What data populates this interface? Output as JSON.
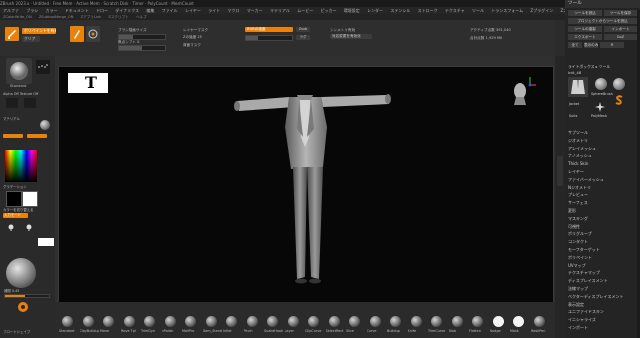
{
  "titlebar": {
    "text": "ZBrush 2023.x  ·  Untitled  ·  Free Mem  ·  Active Mem  ·  Scratch Disk  ·  Timer  ·  PolyCount  ·  MeshCount"
  },
  "menubar": {
    "items": [
      "アルファ",
      "ブラシ",
      "カラー",
      "ドキュメント",
      "ドロー",
      "ダイナミクス",
      "編集",
      "ファイル",
      "レイヤー",
      "ライト",
      "マクロ",
      "マーカー",
      "マテリアル",
      "ムービー",
      "ピッカー",
      "環境設定",
      "レンダー",
      "ステンシル",
      "ストローク",
      "テクスチャ",
      "ツール",
      "トランスフォーム",
      "Zプラグイン",
      "Zスクリプト",
      "ヘルプ"
    ]
  },
  "infobar": {
    "items": [
      "ZColorWrite_ON",
      "ZSubtoolMerge_ON",
      "ZアプリLink",
      "Zスクリプト",
      "ヘルプ"
    ],
    "clock": "0.125 / 0.070"
  },
  "toolbar": {
    "polish_label": "ポリペイントを有効化",
    "clear_label": "クリア",
    "brush_size_label": "ブラシ描画サイズ",
    "brush_size_value": "64",
    "dynamic_label": "ダイナミック",
    "focal_label": "焦点シフト 0",
    "focal_value": "0",
    "z_intensity_label": "Zの強度 25",
    "rgb_intensity_label": "RGBの強度",
    "layer_mask_label": "レイヤーマスク",
    "sub_label": "Zsub",
    "lazy_label": "ラグ",
    "backface_label": "背面マスク",
    "symmetry_label": "シンメトリ有効",
    "persp_label": "パースペクティブ",
    "active_points_label": "アクティブ点数",
    "active_points_value": "391,040",
    "total_points_label": "合計点数",
    "total_points_value": "1,929 Mil",
    "dynamesh_label": "ダイナメッシュを有効化",
    "pose_label": "対応変更を有効化"
  },
  "leftshelf": {
    "brush_name": "Standard",
    "stroke_name": "Dots",
    "alpha_name": "Alpha Off",
    "texture_name": "Texture Off",
    "material_label": "マテリアル",
    "gradient_label": "グラデーション",
    "switch_color_label": "カラーを切り替える",
    "flat_label": "入力モード",
    "skin_label": "スキン",
    "blend_label": "補間 0.45",
    "bottom_label": "フロートシェイプ"
  },
  "bottomshelf": {
    "brushes": [
      "Standard",
      "ClayBuildup",
      "Move",
      "Move Tpl",
      "TrimDyn",
      "hPolish",
      "MaliPro",
      "Dam_Standard",
      "Inflat",
      "Pinch",
      "SnakeHook",
      "Layer",
      "ClipCurve",
      "SelectRect",
      "Slice",
      "Curve",
      "Buildup",
      "Knife",
      "TrimCurve",
      "Blob",
      "Flatten",
      "Nudge",
      "Mask",
      "MaskPen"
    ]
  },
  "viewport": {
    "alpha_letter": "T"
  },
  "rightpanel": {
    "header": "ツール",
    "top_buttons": [
      "ツールを読込",
      "ツールを保存",
      "プロジェクトからツールを読込",
      "ツールの複製",
      "インポート",
      "エクスポート",
      "GoZ",
      "全て",
      "表示のみ",
      "R"
    ],
    "lightbox_label": "ライトボックス ▸ ツール",
    "current_tool": "Intt_48",
    "tools": [
      "Jacket",
      "SphereBrush",
      "AlphaBrush",
      "SimpleBrush",
      "Suits",
      "PolyMesh"
    ],
    "sections": [
      "サブツール",
      "ジオメトリ",
      "アレイメッシュ",
      "ナノメッシュ",
      "Thick Skin",
      "レイヤー",
      "ファイバーメッシュ",
      "Nジオメトリ",
      "プレビュー",
      "サーフェス",
      "変形",
      "マスキング",
      "可視性",
      "ポリグループ",
      "コンタクト",
      "モーフターゲット",
      "ポリペイント",
      "UVマップ",
      "テクスチャマップ",
      "ディスプレイスメント",
      "法線マップ",
      "ベクターディスプレイスメント",
      "表示設定",
      "ユニファイドスキン",
      "イニシャライズ",
      "インポート"
    ]
  },
  "colors": {
    "accent": "#e8820c",
    "bg": "#2b2b2b",
    "viewport": "#070707",
    "panel": "#242424"
  }
}
